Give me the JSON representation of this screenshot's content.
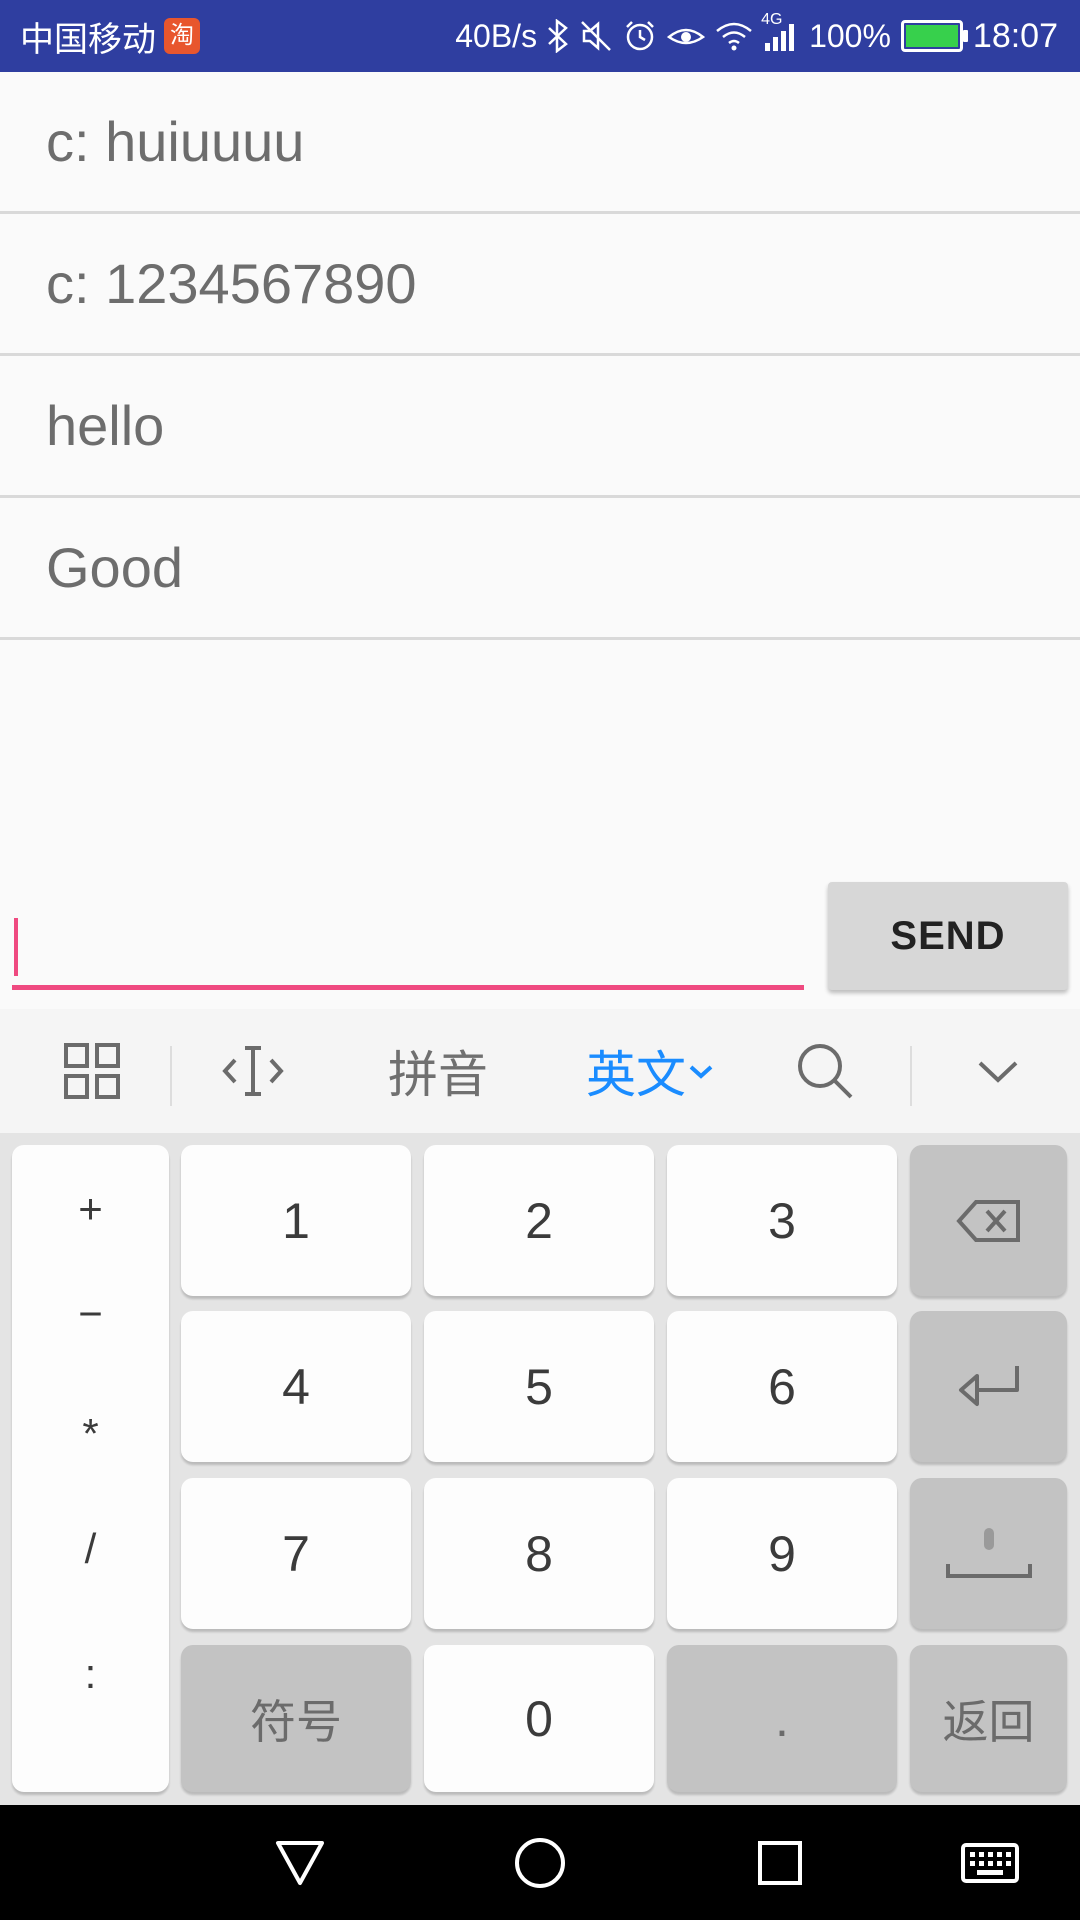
{
  "status_bar": {
    "carrier": "中国移动",
    "app_badge": "淘",
    "net_speed": "40B/s",
    "network_type": "4G",
    "battery_percent": "100%",
    "battery_level": 1.0,
    "time": "18:07",
    "background_color": "#2f3ea0"
  },
  "messages": [
    {
      "text": "c: huiuuuu"
    },
    {
      "text": "c: 1234567890"
    },
    {
      "text": "hello"
    },
    {
      "text": "Good"
    }
  ],
  "composer": {
    "input_value": "",
    "send_label": "SEND",
    "accent_color": "#ef4a80"
  },
  "ime_toolbar": {
    "pinyin_label": "拼音",
    "english_label": "英文",
    "active_color": "#1a8cff"
  },
  "keyboard": {
    "symbols": [
      "+",
      "−",
      "*",
      "/",
      ":"
    ],
    "digits": [
      "1",
      "2",
      "3",
      "4",
      "5",
      "6",
      "7",
      "8",
      "9",
      "0"
    ],
    "symbol_key_label": "符号",
    "dot_key_label": ".",
    "back_key_label": "返回"
  }
}
